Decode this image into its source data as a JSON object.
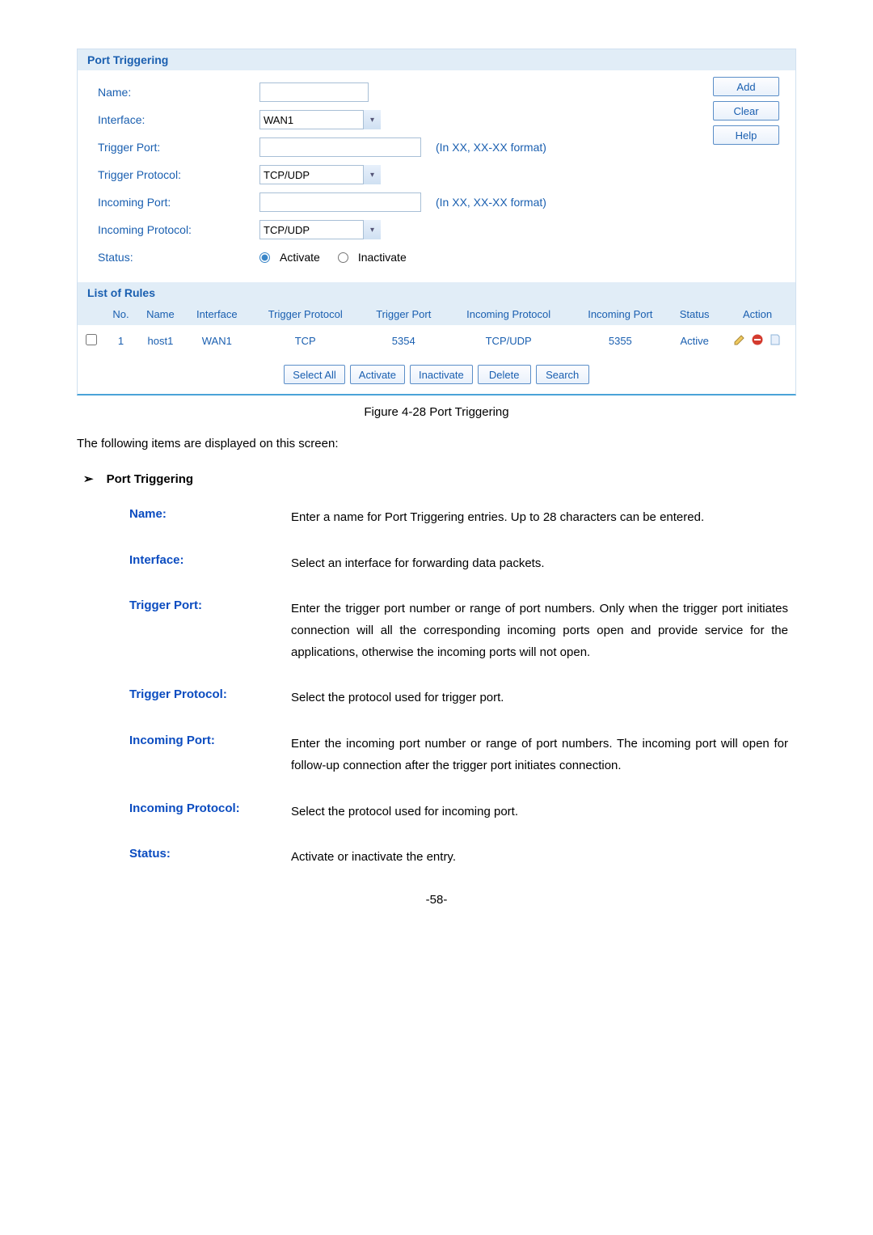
{
  "panel": {
    "section1_title": "Port Triggering",
    "labels": {
      "name": "Name:",
      "interface": "Interface:",
      "trigger_port": "Trigger Port:",
      "trigger_protocol": "Trigger Protocol:",
      "incoming_port": "Incoming Port:",
      "incoming_protocol": "Incoming Protocol:",
      "status": "Status:"
    },
    "values": {
      "name": "",
      "interface": "WAN1",
      "trigger_port": "",
      "trigger_protocol": "TCP/UDP",
      "incoming_port": "",
      "incoming_protocol": "TCP/UDP"
    },
    "hints": {
      "port_format": "(In XX, XX-XX format)"
    },
    "status_opts": {
      "activate": "Activate",
      "inactivate": "Inactivate"
    },
    "buttons": {
      "add": "Add",
      "clear": "Clear",
      "help": "Help"
    },
    "section2_title": "List of Rules",
    "table_headers": [
      "No.",
      "Name",
      "Interface",
      "Trigger Protocol",
      "Trigger Port",
      "Incoming Protocol",
      "Incoming Port",
      "Status",
      "Action"
    ],
    "rows": [
      {
        "no": "1",
        "name": "host1",
        "interface": "WAN1",
        "trigger_protocol": "TCP",
        "trigger_port": "5354",
        "incoming_protocol": "TCP/UDP",
        "incoming_port": "5355",
        "status": "Active"
      }
    ],
    "bottom_buttons": {
      "select_all": "Select All",
      "activate": "Activate",
      "inactivate": "Inactivate",
      "delete": "Delete",
      "search": "Search"
    }
  },
  "figure_caption": "Figure 4-28 Port Triggering",
  "intro_text": "The following items are displayed on this screen:",
  "bullet_heading": "Port Triggering",
  "definitions": [
    {
      "term": "Name:",
      "desc": "Enter a name for Port Triggering entries. Up to 28 characters can be entered."
    },
    {
      "term": "Interface:",
      "desc": "Select an interface for forwarding data packets."
    },
    {
      "term": "Trigger Port:",
      "desc": "Enter the trigger port number or range of port numbers. Only when the trigger port initiates connection will all the corresponding incoming ports open and provide service for the applications, otherwise the incoming ports will not open."
    },
    {
      "term": "Trigger Protocol:",
      "desc": "Select the protocol used for trigger port."
    },
    {
      "term": "Incoming Port:",
      "desc": "Enter the incoming port number or range of port numbers. The incoming port will open for follow-up connection after the trigger port initiates connection."
    },
    {
      "term": "Incoming Protocol:",
      "desc": "Select the protocol used for incoming port."
    },
    {
      "term": "Status:",
      "desc": "Activate or inactivate the entry."
    }
  ],
  "page_number": "-58-"
}
